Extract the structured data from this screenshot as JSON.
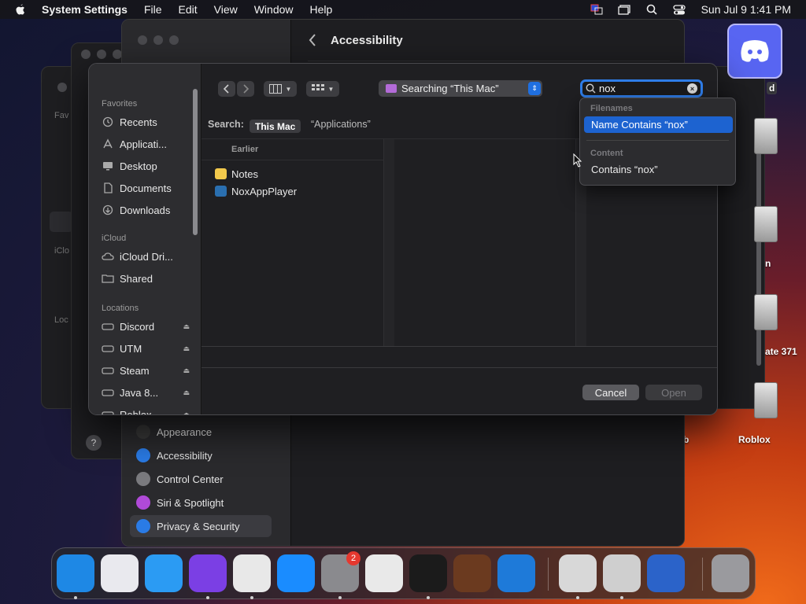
{
  "menubar": {
    "app_name": "System Settings",
    "items": [
      "File",
      "Edit",
      "View",
      "Window",
      "Help"
    ],
    "clock": "Sun Jul 9  1:41 PM"
  },
  "desktop": {
    "labels": [
      "d",
      "n",
      "ate 371",
      "b",
      "Roblox"
    ]
  },
  "system_settings": {
    "page_title": "Accessibility",
    "sidebar_items": [
      {
        "label": "Appearance",
        "icon": "appearance-icon",
        "color": "#3a3a3a"
      },
      {
        "label": "Accessibility",
        "icon": "accessibility-icon",
        "color": "#2a7be6"
      },
      {
        "label": "Control Center",
        "icon": "control-center-icon",
        "color": "#7a7a7e"
      },
      {
        "label": "Siri & Spotlight",
        "icon": "siri-icon",
        "color": "#b04ad8"
      },
      {
        "label": "Privacy & Security",
        "icon": "hand-icon",
        "color": "#2a7be6",
        "selected": true
      }
    ],
    "help": "?"
  },
  "bg_windows": {
    "labels": [
      "Fav",
      "iClo",
      "Loc"
    ]
  },
  "dialog": {
    "sidebar": {
      "sections": [
        {
          "title": "Favorites",
          "items": [
            {
              "label": "Recents",
              "icon": "clock-icon"
            },
            {
              "label": "Applicati...",
              "icon": "applications-icon"
            },
            {
              "label": "Desktop",
              "icon": "desktop-icon"
            },
            {
              "label": "Documents",
              "icon": "document-icon"
            },
            {
              "label": "Downloads",
              "icon": "downloads-icon"
            }
          ]
        },
        {
          "title": "iCloud",
          "items": [
            {
              "label": "iCloud Dri...",
              "icon": "cloud-icon"
            },
            {
              "label": "Shared",
              "icon": "shared-folder-icon"
            }
          ]
        },
        {
          "title": "Locations",
          "items": [
            {
              "label": "Discord",
              "icon": "drive-icon",
              "eject": true
            },
            {
              "label": "UTM",
              "icon": "drive-icon",
              "eject": true
            },
            {
              "label": "Steam",
              "icon": "drive-icon",
              "eject": true
            },
            {
              "label": "Java 8...",
              "icon": "drive-icon",
              "eject": true
            },
            {
              "label": "Roblox",
              "icon": "drive-icon",
              "eject": true
            }
          ]
        }
      ]
    },
    "location_popup": "Searching “This Mac”",
    "search_value": "nox",
    "scope_label": "Search:",
    "scope_this_mac": "This Mac",
    "scope_apps": "“Applications”",
    "column_header": "Earlier",
    "files": [
      {
        "name": "Notes",
        "icon": "notes-icon",
        "color": "#f2c94c"
      },
      {
        "name": "NoxAppPlayer",
        "icon": "nox-icon",
        "color": "#2a6fb0"
      }
    ],
    "cancel_label": "Cancel",
    "open_label": "Open"
  },
  "search_dropdown": {
    "filenames_header": "Filenames",
    "name_contains": "Name Contains “nox”",
    "content_header": "Content",
    "contains": "Contains “nox”"
  },
  "dock": {
    "apps": [
      {
        "name": "finder-icon",
        "color": "#1e88e5",
        "running": true
      },
      {
        "name": "launchpad-icon",
        "color": "#e9e9ee",
        "running": false
      },
      {
        "name": "safari-icon",
        "color": "#2b9bf3",
        "running": false
      },
      {
        "name": "firefox-icon",
        "color": "#7b3fe4",
        "running": true
      },
      {
        "name": "chrome-icon",
        "color": "#e8e8e8",
        "running": true
      },
      {
        "name": "app-store-icon",
        "color": "#1a8cff",
        "running": false
      },
      {
        "name": "system-settings-icon",
        "color": "#8a8a8e",
        "running": true,
        "badge": "2"
      },
      {
        "name": "script-editor-icon",
        "color": "#e9e9e9",
        "running": false
      },
      {
        "name": "terminal-icon",
        "color": "#1b1b1b",
        "running": true
      },
      {
        "name": "garageband-icon",
        "color": "#6b3a1f",
        "running": false
      },
      {
        "name": "vscode-icon",
        "color": "#1e7ad9",
        "running": false
      },
      {
        "name": "cocoapods-icon",
        "color": "#d8d8d8",
        "running": true
      },
      {
        "name": "installer-icon",
        "color": "#cfcfcf",
        "running": true
      },
      {
        "name": "migration-icon",
        "color": "#2b63c9",
        "running": false
      },
      {
        "name": "trash-icon",
        "color": "#9a9a9e",
        "running": false
      }
    ]
  }
}
